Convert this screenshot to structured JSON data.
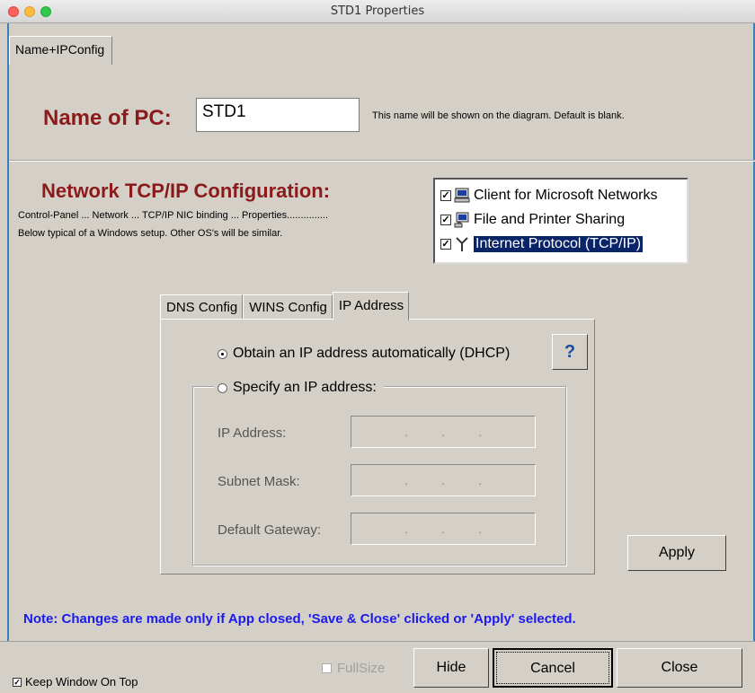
{
  "window": {
    "title": "STD1 Properties"
  },
  "top_tab": {
    "label": "Name+IPConfig"
  },
  "name_section": {
    "label": "Name of PC:",
    "value": "STD1",
    "hint": "This name will be shown on the diagram.  Default is blank."
  },
  "network_section": {
    "heading": "Network TCP/IP Configuration:",
    "line1": "Control-Panel ... Network ... TCP/IP NIC binding ... Properties...............",
    "line2": "Below typical of a Windows setup.  Other OS's will be similar.",
    "components": [
      {
        "label": "Client for Microsoft Networks",
        "checked": true,
        "icon": "network-client-icon"
      },
      {
        "label": "File and Printer Sharing",
        "checked": true,
        "icon": "file-printer-sharing-icon"
      },
      {
        "label": "Internet Protocol (TCP/IP)",
        "checked": true,
        "icon": "protocol-icon",
        "selected": true
      }
    ]
  },
  "tabs": [
    {
      "label": "DNS Config"
    },
    {
      "label": "WINS Config"
    },
    {
      "label": "IP Address",
      "active": true
    }
  ],
  "ip_panel": {
    "dhcp_label": "Obtain an IP address automatically  (DHCP)",
    "specify_label": "Specify an IP address:",
    "help": "?",
    "fields": [
      {
        "label": "IP Address:"
      },
      {
        "label": "Subnet Mask:"
      },
      {
        "label": "Default Gateway:"
      }
    ],
    "dot": ".",
    "apply": "Apply"
  },
  "note": "Note: Changes are made only if App closed, 'Save & Close' clicked or 'Apply' selected.",
  "footer": {
    "keep_on_top": "Keep Window On Top",
    "fullsize": "FullSize",
    "hide": "Hide",
    "cancel": "Cancel",
    "close": "Close",
    "check_mark": "✓"
  },
  "colors": {
    "heading": "#8b1a1a",
    "note": "#1a1aee",
    "frame": "#3d7fb7",
    "selection": "#0a246a"
  }
}
